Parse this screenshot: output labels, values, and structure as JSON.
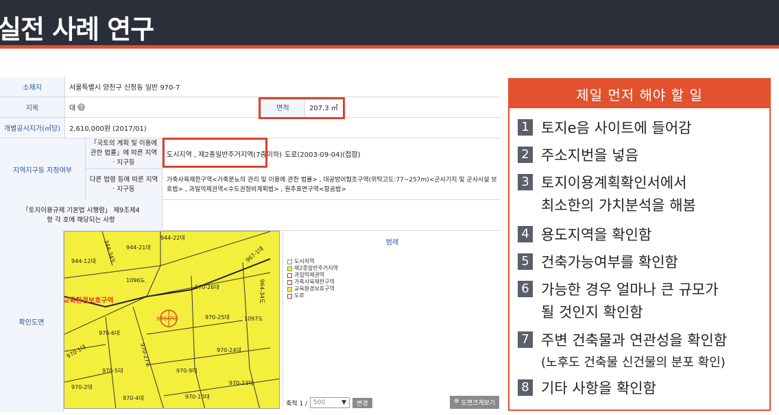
{
  "header": {
    "title": "실전 사례 연구"
  },
  "doc": {
    "rows": [
      {
        "label": "소재지",
        "value": "서울특별시 양천구 신정동 일반 970-7"
      },
      {
        "label": "지목",
        "value": "대",
        "area_label": "면적",
        "area_value": "207.3 ㎡"
      },
      {
        "label": "개별공시지가(㎡당)",
        "value": "2,610,000원 (2017/01)"
      }
    ],
    "zone": {
      "label": "지역지구등 지정여부",
      "sub1_label": "「국토의 계획 및 이용에 관한 법률」에 따른 지역 · 지구등",
      "sub1_value_boxed": "도시지역 , 제2종일반주거지역(7층이하)",
      "sub1_value_rest": "도로(2003-09-04)(접합)",
      "sub2_label": "다른 법령 등에 따른 지역 · 지구등",
      "sub2_value": "가축사육제한구역<가축분뇨의 관리 및 이용에 관한 법률> , 대공방어협조구역(위탁고도:77~257m)<군사기지 및 군사시설 보호법> , 과밀억제권역<수도권정비계획법> , 원추표면구역<항공법>"
    },
    "regulation": {
      "label": "「토지이용규제 기본법 시행령」 제9조제4항 각 호에 해당되는 사항"
    },
    "map_section": {
      "label": "확인도면",
      "map_labels": [
        "944-12대",
        "944-21대",
        "944-22대",
        "344-34도",
        "1096도",
        "970-26대",
        "967-1대",
        "970-25대",
        "970-7대",
        "1097도",
        "970-6대",
        "970-1대",
        "970-27도",
        "970-24대",
        "970-5대",
        "970-9대",
        "970-2대",
        "970-23대",
        "970-4대",
        "970-10대",
        "교육환경보호구역",
        "964-34도"
      ],
      "legend_title": "범례",
      "legend_items": [
        {
          "name": "도시지역",
          "color": "#ffffff"
        },
        {
          "name": "제2종일반주거지역",
          "color": "#f4ef3c"
        },
        {
          "name": "과밀억제권역",
          "color": "#ffffff"
        },
        {
          "name": "가축사육제한구역",
          "color": "#ffffff"
        },
        {
          "name": "교육환경보호구역",
          "color": "#f4ef3c"
        },
        {
          "name": "도로",
          "color": "#ffffff"
        }
      ],
      "scale_label": "축척 1 /",
      "scale_value": "500",
      "change_button": "변경",
      "enlarge_button": "도면크게보기"
    }
  },
  "panel": {
    "title": "제일 먼저 해야 할 일",
    "steps": [
      {
        "num": "1",
        "lines": [
          "토지e음 사이트에 들어감"
        ]
      },
      {
        "num": "2",
        "lines": [
          "주소지번을 넣음"
        ]
      },
      {
        "num": "3",
        "lines": [
          "토지이용계획확인서에서",
          "최소한의 가치분석을 해봄"
        ]
      },
      {
        "num": "4",
        "lines": [
          "용도지역을 확인함"
        ]
      },
      {
        "num": "5",
        "lines": [
          "건축가능여부를 확인함"
        ]
      },
      {
        "num": "6",
        "lines": [
          "가능한 경우 얼마나 큰 규모가",
          "될 것인지 확인함"
        ]
      },
      {
        "num": "7",
        "lines": [
          "주변 건축물과 연관성을 확인함",
          "(노후도 건축물 신건물의 분포 확인)"
        ]
      },
      {
        "num": "8",
        "lines": [
          "기타 사항을 확인함"
        ]
      }
    ]
  },
  "colors": {
    "accent": "#e2522e",
    "header_bg": "#2b2f3a",
    "map_yellow": "#f4ef3c"
  }
}
